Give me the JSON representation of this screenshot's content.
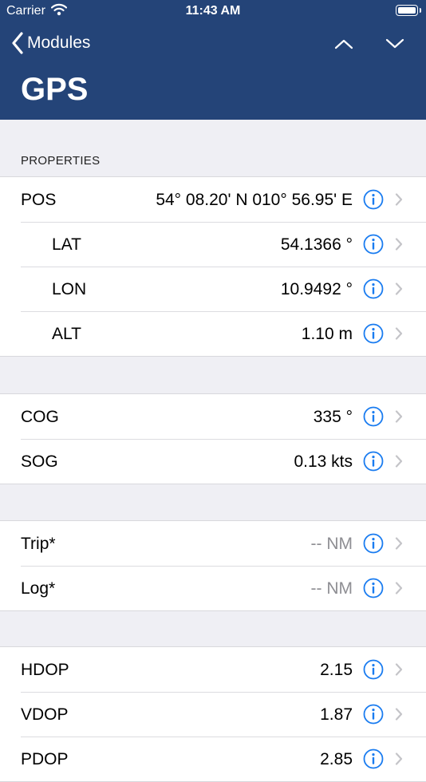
{
  "status_bar": {
    "carrier": "Carrier",
    "time": "11:43 AM"
  },
  "nav": {
    "back_label": "Modules",
    "title": "GPS"
  },
  "section": {
    "label": "PROPERTIES"
  },
  "groups": [
    {
      "rows": [
        {
          "label": "POS",
          "value": "54° 08.20' N 010° 56.95' E"
        },
        {
          "label": "LAT",
          "value": "54.1366 °"
        },
        {
          "label": "LON",
          "value": "10.9492 °"
        },
        {
          "label": "ALT",
          "value": "1.10 m"
        }
      ]
    },
    {
      "rows": [
        {
          "label": "COG",
          "value": "335 °"
        },
        {
          "label": "SOG",
          "value": "0.13 kts"
        }
      ]
    },
    {
      "rows": [
        {
          "label": "Trip*",
          "value": "-- NM"
        },
        {
          "label": "Log*",
          "value": "-- NM"
        }
      ]
    },
    {
      "rows": [
        {
          "label": "HDOP",
          "value": "2.15"
        },
        {
          "label": "VDOP",
          "value": "1.87"
        },
        {
          "label": "PDOP",
          "value": "2.85"
        }
      ]
    }
  ],
  "colors": {
    "nav_bar": "#244478",
    "accent": "#1a7cf0",
    "chevron": "#c4c4c8"
  },
  "icons": {
    "info": "info-circle-icon",
    "chevron": "chevron-right-icon"
  }
}
